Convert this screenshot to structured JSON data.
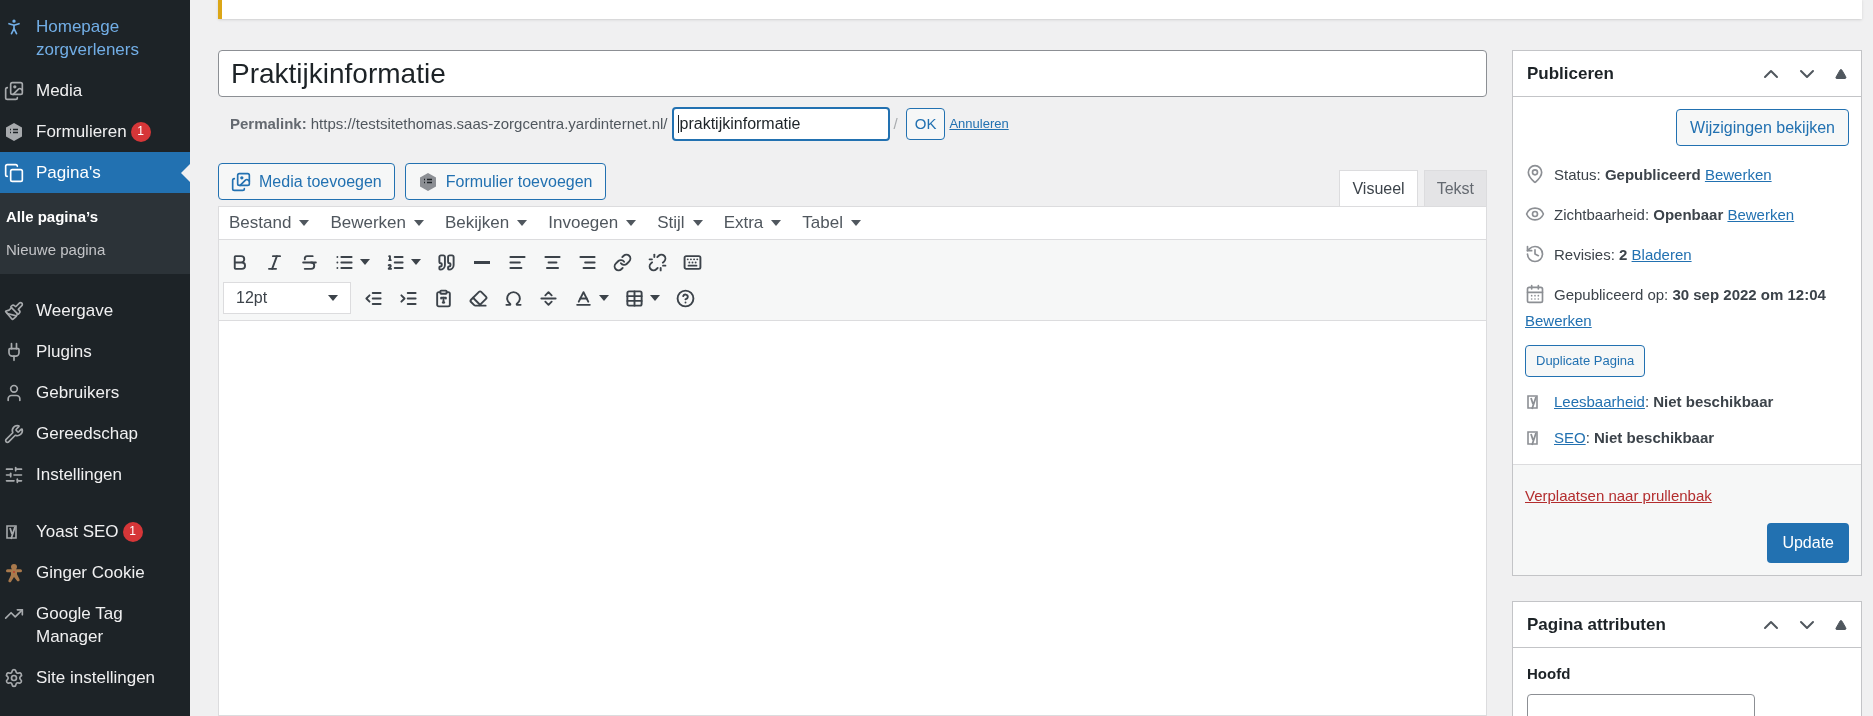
{
  "sidebar": {
    "groups": [
      [
        {
          "kind": "homepage",
          "label": "Homepage zorgverleners",
          "hovered": true,
          "selected": false
        },
        {
          "kind": "media",
          "label": "Media",
          "hovered": false,
          "selected": false
        },
        {
          "kind": "forms",
          "label": "Formulieren",
          "badge": "1",
          "hovered": false,
          "selected": false
        },
        {
          "kind": "pages",
          "label": "Pagina's",
          "selected": true,
          "children": [
            {
              "label": "Alle pagina’s",
              "selected": true
            },
            {
              "label": "Nieuwe pagina",
              "selected": false
            }
          ]
        }
      ],
      [
        {
          "kind": "appearance",
          "label": "Weergave",
          "hovered": false,
          "selected": false
        },
        {
          "kind": "plugins",
          "label": "Plugins",
          "hovered": false,
          "selected": false
        },
        {
          "kind": "users",
          "label": "Gebruikers",
          "hovered": false,
          "selected": false
        },
        {
          "kind": "tools",
          "label": "Gereedschap",
          "hovered": false,
          "selected": false
        },
        {
          "kind": "settings",
          "label": "Instellingen",
          "hovered": false,
          "selected": false
        }
      ],
      [
        {
          "kind": "yoast",
          "label": "Yoast SEO",
          "badge": "1",
          "hovered": false,
          "selected": false
        },
        {
          "kind": "cookie",
          "label": "Ginger Cookie",
          "hovered": false,
          "selected": false
        },
        {
          "kind": "tagmanager",
          "label": "Google Tag Manager",
          "hovered": false,
          "selected": false
        },
        {
          "kind": "site-settings",
          "label": "Site instellingen",
          "hovered": false,
          "selected": false
        }
      ]
    ]
  },
  "title_field": {
    "value": "Praktijkinformatie"
  },
  "permalink": {
    "label": "Permalink:",
    "base_url": "https://testsitethomas.saas-zorgcentra.yardinternet.nl/",
    "slug": "praktijkinformatie",
    "trailing": "/",
    "ok_button": "OK",
    "cancel_link": "Annuleren"
  },
  "media_buttons": [
    {
      "kind": "media",
      "label": "Media toevoegen"
    },
    {
      "kind": "form",
      "label": "Formulier toevoegen"
    }
  ],
  "editor_tabs": [
    {
      "label": "Visueel",
      "selected": true
    },
    {
      "label": "Tekst",
      "selected": false
    }
  ],
  "editor_menus": [
    "Bestand",
    "Bewerken",
    "Bekijken",
    "Invoegen",
    "Stijl",
    "Extra",
    "Tabel"
  ],
  "toolbar_rows": [
    [
      {
        "kind": "bold"
      },
      {
        "kind": "italic"
      },
      {
        "kind": "strike"
      },
      {
        "kind": "bullist",
        "dropdown": true
      },
      {
        "kind": "numlist",
        "dropdown": true
      },
      {
        "kind": "quote"
      },
      {
        "kind": "hr"
      },
      {
        "kind": "alignleft"
      },
      {
        "kind": "aligncenter"
      },
      {
        "kind": "alignright"
      },
      {
        "kind": "link"
      },
      {
        "kind": "unlink"
      },
      {
        "kind": "toolbar"
      }
    ],
    [
      {
        "kind": "fontsize",
        "value": "12pt"
      },
      {
        "kind": "outdent"
      },
      {
        "kind": "indent"
      },
      {
        "kind": "pastetext"
      },
      {
        "kind": "eraser"
      },
      {
        "kind": "omega"
      },
      {
        "kind": "more"
      },
      {
        "kind": "textcolor",
        "dropdown": true
      },
      {
        "kind": "table",
        "dropdown": true
      },
      {
        "kind": "help"
      }
    ]
  ],
  "publish_box": {
    "title": "Publiceren",
    "preview_button": "Wijzigingen bekijken",
    "rows": [
      {
        "kind": "status",
        "label": "Status:",
        "value": "Gepubliceerd",
        "link": "Bewerken"
      },
      {
        "kind": "visibility",
        "label": "Zichtbaarheid:",
        "value": "Openbaar",
        "link": "Bewerken"
      },
      {
        "kind": "revisions",
        "label": "Revisies:",
        "value": "2",
        "link": "Bladeren"
      },
      {
        "kind": "date",
        "label": "Gepubliceerd op:",
        "value": "30 sep 2022 om 12:04",
        "link": "Bewerken"
      }
    ],
    "duplicate_button": "Duplicate Pagina",
    "seo_rows": [
      {
        "link": "Leesbaarheid",
        "suffix": ":",
        "value": "Niet beschikbaar"
      },
      {
        "link": "SEO",
        "suffix": ":",
        "value": "Niet beschikbaar"
      }
    ],
    "trash_link": "Verplaatsen naar prullenbak",
    "update_button": "Update"
  },
  "attributes_box": {
    "title": "Pagina attributen",
    "field_label": "Hoofd"
  }
}
